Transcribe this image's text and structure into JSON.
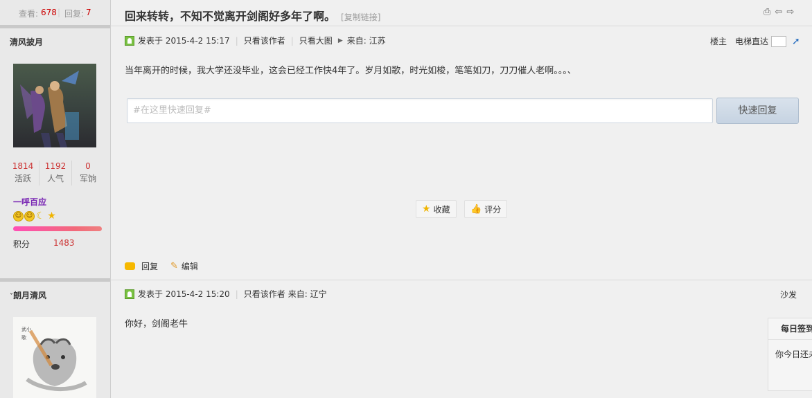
{
  "thread": {
    "views_label": "查看:",
    "views": "678",
    "replies_label": "回复:",
    "replies": "7",
    "title": "回来转转，不知不觉离开剑阁好多年了啊。",
    "copy_link": "[复制链接]"
  },
  "post1": {
    "author": "清风披月",
    "stats": [
      {
        "value": "1814",
        "label": "活跃"
      },
      {
        "value": "1192",
        "label": "人气"
      },
      {
        "value": "0",
        "label": "军饷"
      }
    ],
    "rank": "一呼百应",
    "points_label": "积分",
    "points": "1483",
    "posted": "发表于 2015-4-2 15:17",
    "only_author": "只看该作者",
    "big_image": "只看大图",
    "from": "来自: 江苏",
    "floor": "楼主",
    "elevator": "电梯直达",
    "content": "当年离开的时候，我大学还没毕业，这会已经工作快4年了。岁月如歌，时光如梭，笔笔如刀，刀刀催人老啊。。。、",
    "reply_placeholder": "#在这里快速回复#",
    "reply_button": "快速回复",
    "favorite": "收藏",
    "rate": "评分",
    "reply": "回复",
    "edit": "编辑"
  },
  "post2": {
    "author": "朗月清风",
    "posted": "发表于 2015-4-2 15:20",
    "only_author": "只看该作者",
    "from": "来自: 辽宁",
    "floor": "沙发",
    "content": "你好，剑阁老牛"
  },
  "side": {
    "title": "每日签到",
    "body": "你今日还未签到"
  },
  "colors": {
    "accent_red": "#c33",
    "rank_purple": "#7a28b4"
  }
}
